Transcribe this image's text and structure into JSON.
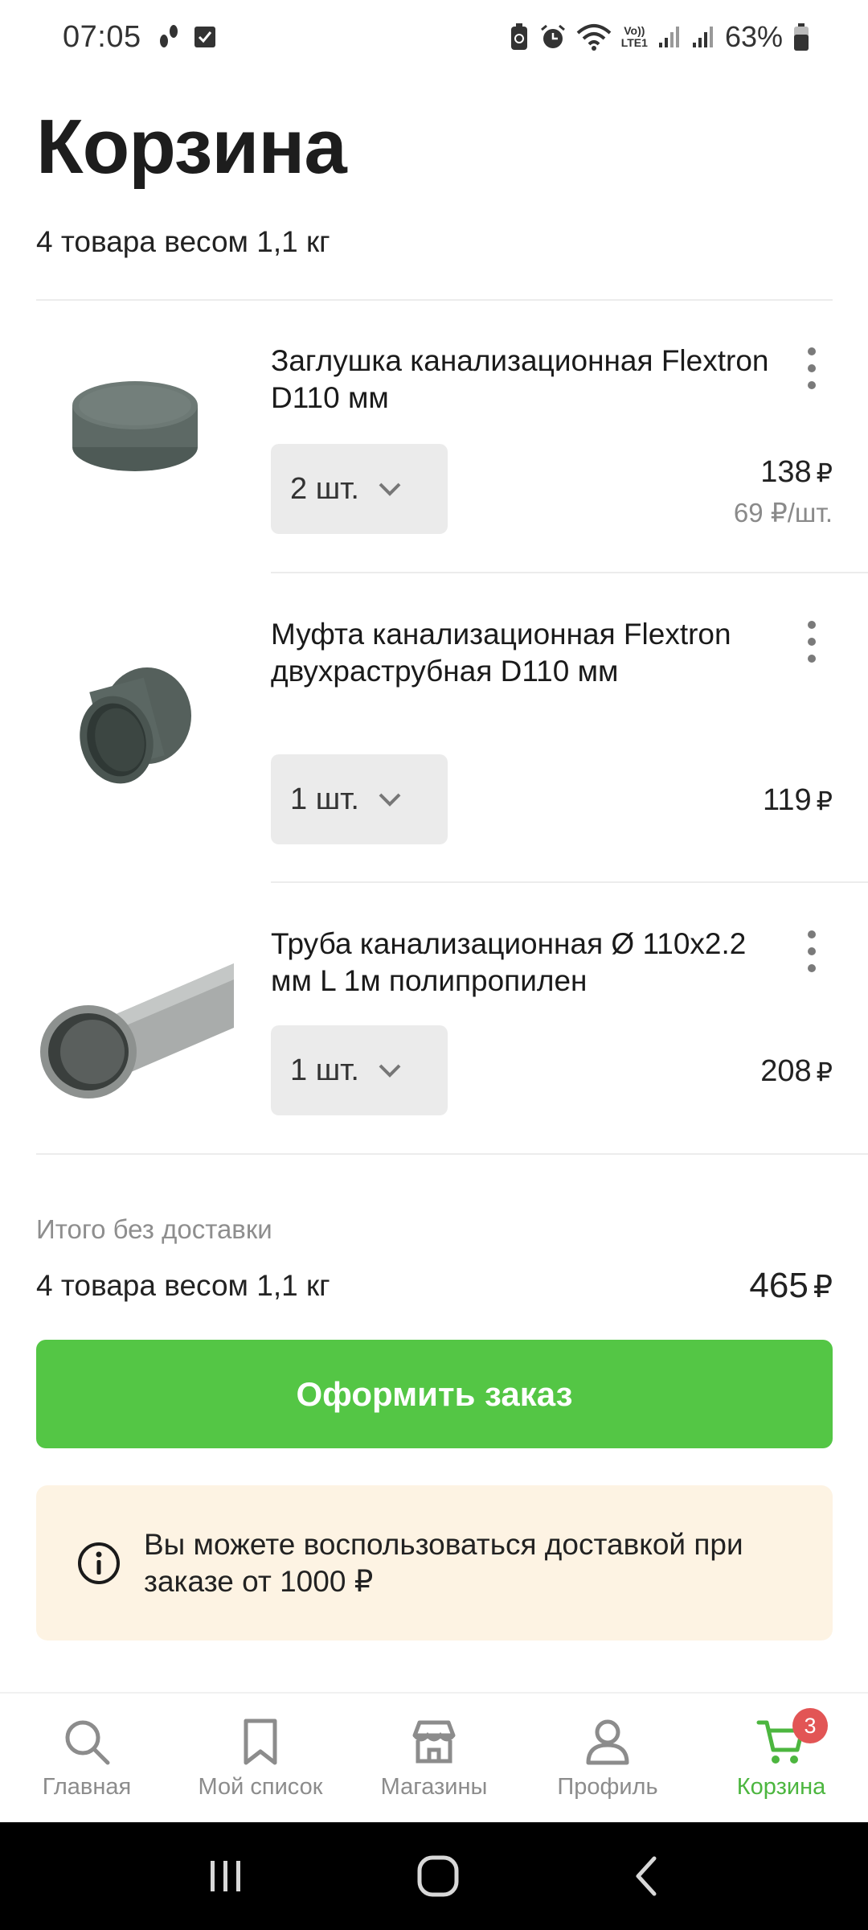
{
  "status_bar": {
    "time": "07:05",
    "battery_percent": "63%",
    "left_icons": [
      "steps-icon",
      "checkbox-icon"
    ],
    "right_icons": [
      "recycle-battery-icon",
      "alarm-icon",
      "wifi-icon",
      "volte-lte1-icon",
      "signal-icon",
      "signal-icon",
      "battery-icon"
    ],
    "volte_label_top": "Vo))",
    "volte_label_bottom": "LTE1"
  },
  "header": {
    "title": "Корзина",
    "subtitle": "4 товара весом 1,1 кг"
  },
  "currency_symbol": "₽",
  "items": [
    {
      "name": "Заглушка канализационная Flextron D110 мм",
      "quantity": "2 шт.",
      "price": "138",
      "unit_price": "69  ₽/шт.",
      "image": "pipe-cap-image"
    },
    {
      "name": "Муфта канализационная Flextron двухраструбная D110 мм",
      "quantity": "1 шт.",
      "price": "119",
      "unit_price": "",
      "image": "pipe-coupling-image"
    },
    {
      "name": "Труба канализационная Ø 110x2.2 мм L 1м полипропилен",
      "quantity": "1 шт.",
      "price": "208",
      "unit_price": "",
      "image": "pipe-image"
    }
  ],
  "totals": {
    "caption": "Итого без доставки",
    "summary": "4 товара весом 1,1 кг",
    "price": "465"
  },
  "checkout_button": "Оформить заказ",
  "info": {
    "text": "Вы можете воспользоваться доставкой при заказе от 1000 ₽",
    "icon": "info-icon"
  },
  "bottom_nav": {
    "items": [
      {
        "label": "Главная",
        "icon": "search-icon"
      },
      {
        "label": "Мой список",
        "icon": "bookmark-icon"
      },
      {
        "label": "Магазины",
        "icon": "store-icon"
      },
      {
        "label": "Профиль",
        "icon": "user-icon"
      },
      {
        "label": "Корзина",
        "icon": "cart-icon",
        "badge": "3",
        "active": true
      }
    ]
  },
  "colors": {
    "accent_green": "#54c645",
    "nav_active": "#4cb63f",
    "badge_red": "#e25555",
    "info_bg": "#fdf3e3"
  }
}
